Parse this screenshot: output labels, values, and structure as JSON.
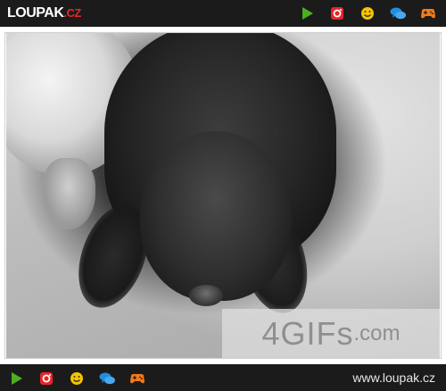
{
  "header": {
    "logo_main": "LOUPAK",
    "logo_tld": ".CZ"
  },
  "icons": [
    {
      "name": "play-icon",
      "color": "#4caf1f"
    },
    {
      "name": "instagram-icon",
      "color": "#e8252b"
    },
    {
      "name": "smiley-icon",
      "color": "#f5c400"
    },
    {
      "name": "chat-icon",
      "color": "#1e8fe0"
    },
    {
      "name": "gamepad-icon",
      "color": "#f07a1a"
    }
  ],
  "content": {
    "watermark_main": "4GIFs",
    "watermark_suffix": ".com"
  },
  "footer": {
    "site_url": "www.loupak.cz"
  }
}
